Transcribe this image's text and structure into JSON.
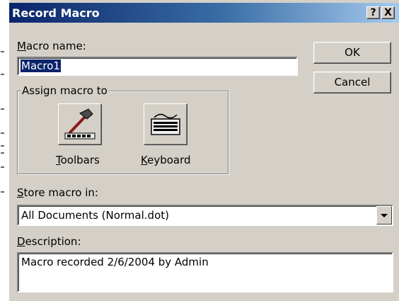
{
  "dialog": {
    "title": "Record Macro",
    "help_label": "?",
    "close_label": "X"
  },
  "macro_name": {
    "label_key": "M",
    "label_rest": "acro name:",
    "value": "Macro1"
  },
  "buttons": {
    "ok": "OK",
    "cancel": "Cancel"
  },
  "assign": {
    "legend": "Assign macro to",
    "toolbars_key": "T",
    "toolbars_rest": "oolbars",
    "keyboard_key": "K",
    "keyboard_rest": "eyboard"
  },
  "store": {
    "label_key": "S",
    "label_rest": "tore macro in:",
    "value": "All Documents (Normal.dot)"
  },
  "description": {
    "label_key": "D",
    "label_rest": "escription:",
    "value": "Macro recorded 2/6/2004 by Admin"
  },
  "colors": {
    "title_start": "#0a246a",
    "title_end": "#a6caf0",
    "face": "#d4d0c8",
    "selection": "#0a246a"
  }
}
